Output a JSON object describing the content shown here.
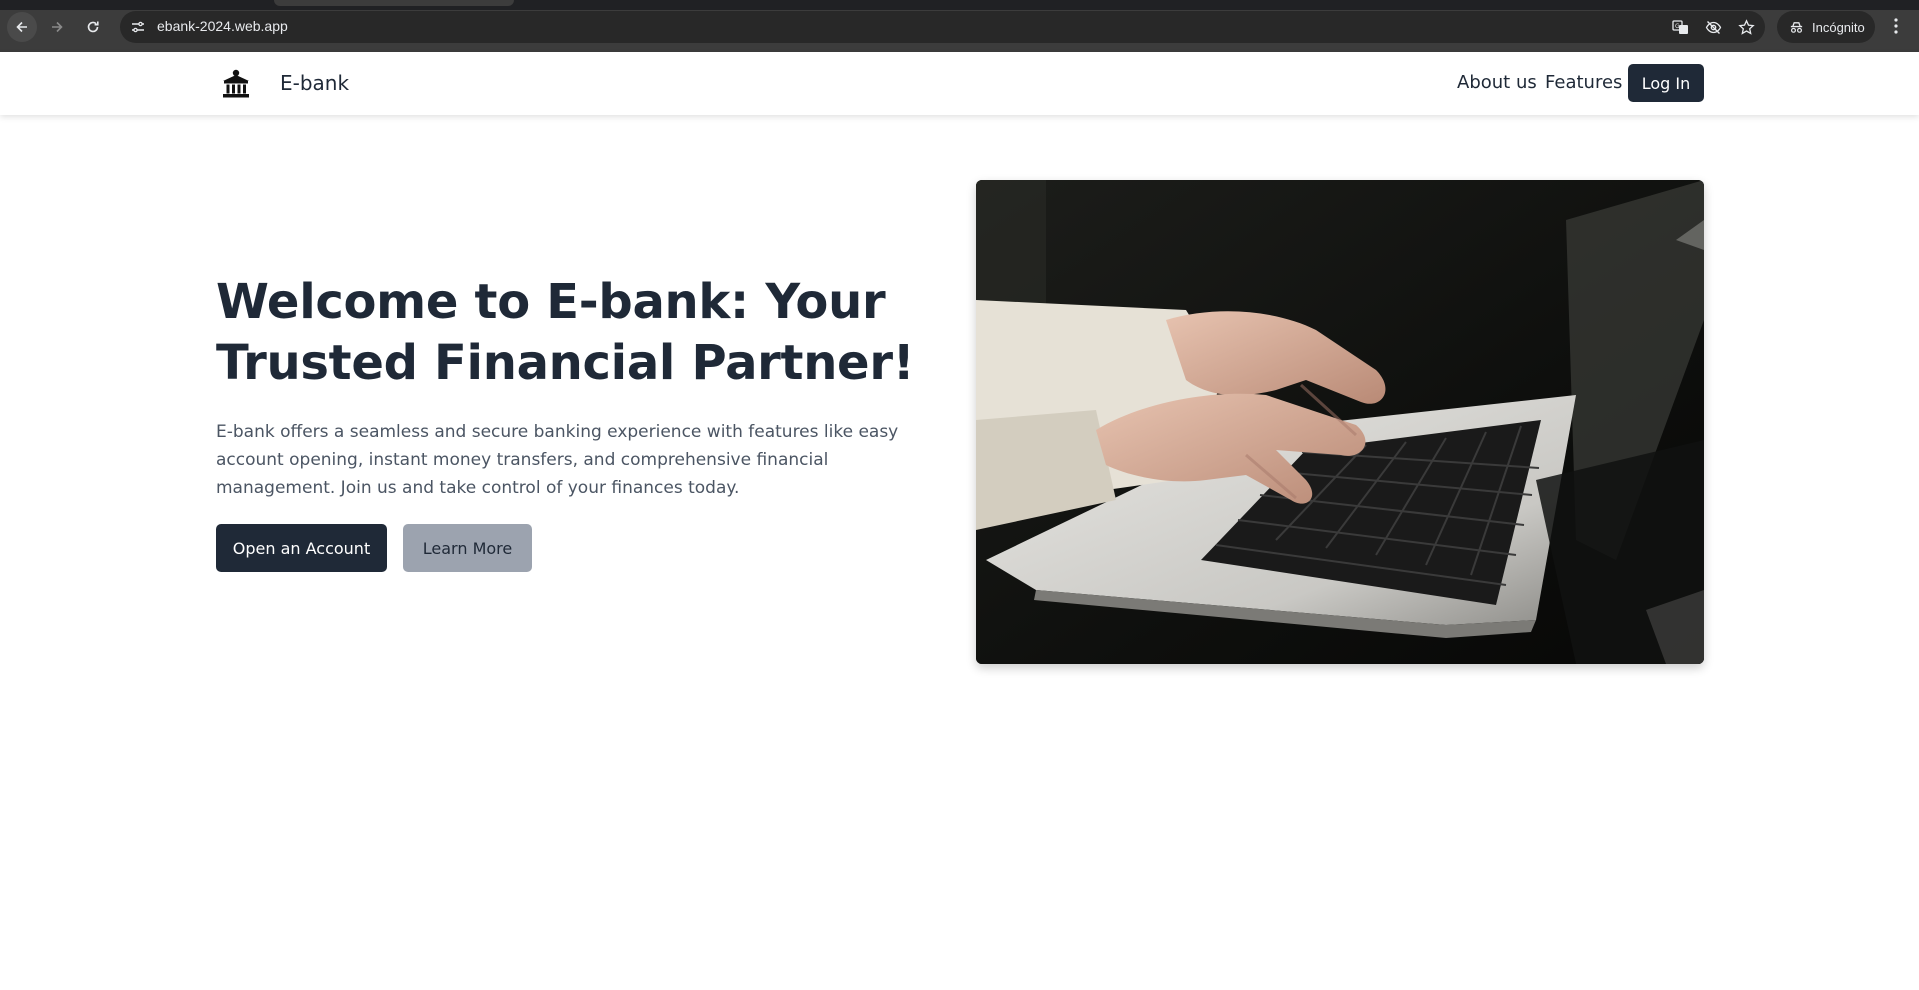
{
  "browser": {
    "url": "ebank-2024.web.app",
    "profile_label": "Incógnito",
    "icons": [
      "back-icon",
      "forward-icon",
      "reload-icon",
      "site-info-icon",
      "translate-icon",
      "eye-off-icon",
      "star-icon",
      "incognito-icon",
      "more-vert-icon"
    ]
  },
  "header": {
    "brand": "E-bank",
    "logo_icon": "bank-icon",
    "nav": [
      {
        "label": "About us"
      },
      {
        "label": "Features"
      }
    ],
    "login_label": "Log In"
  },
  "hero": {
    "title": "Welcome to E-bank: Your Trusted Financial Partner!",
    "description": "E-bank offers a seamless and secure banking experience with features like easy account opening, instant money transfers, and comprehensive financial management. Join us and take control of your finances today.",
    "primary_button": "Open an Account",
    "secondary_button": "Learn More",
    "image_subject": "hands-typing-on-laptop-photo"
  },
  "colors": {
    "primary": "#1f2937",
    "secondary": "#9ca3af",
    "text_muted": "#4b5563"
  }
}
